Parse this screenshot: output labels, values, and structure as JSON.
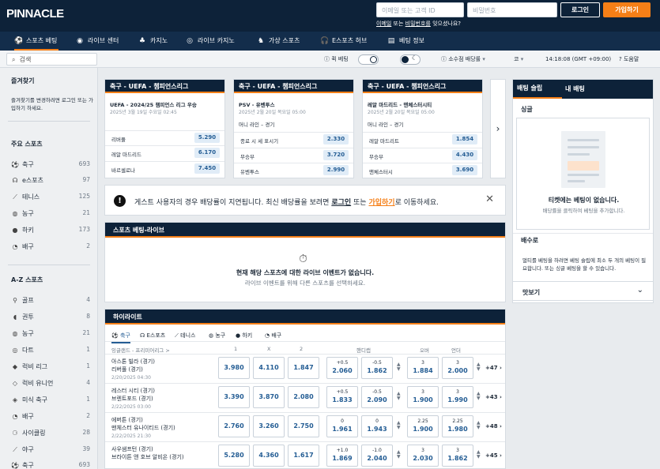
{
  "brand": {
    "logo": "PINNACLE",
    "accent": "#f57f17",
    "navy": "#0d2239"
  },
  "header": {
    "email_placeholder": "이메일 또는 고객 ID",
    "password_placeholder": "비밀번호",
    "login": "로그인",
    "join": "가입하기",
    "forgot_pre": "이메일",
    "forgot_mid": " 또는 ",
    "forgot_link": "비밀번호를",
    "forgot_post": " 잊으셨나요?"
  },
  "nav": [
    "스포츠 베팅",
    "라이브 센터",
    "카지노",
    "라이브 카지노",
    "가상 스포츠",
    "E스포츠 허브",
    "베팅 정보"
  ],
  "utility": {
    "search": "검색",
    "quick_bet": "퀵 베팅",
    "decimal_odds": "소수점 배당률",
    "language": "코",
    "time": "14:18:08 (GMT +09:00)",
    "help": "도움말"
  },
  "sidebar": {
    "favorites_title": "즐겨찾기",
    "favorites_text": "즐겨찾기를 변경하려면 로그인 또는 가입하기 하세요.",
    "main_title": "주요 스포츠",
    "main": [
      {
        "label": "축구",
        "count": "693"
      },
      {
        "label": "e스포츠",
        "count": "97"
      },
      {
        "label": "테니스",
        "count": "125"
      },
      {
        "label": "농구",
        "count": "21"
      },
      {
        "label": "하키",
        "count": "173"
      },
      {
        "label": "배구",
        "count": "2"
      }
    ],
    "az_title": "A-Z 스포츠",
    "az": [
      {
        "label": "골프",
        "count": "4"
      },
      {
        "label": "권투",
        "count": "8"
      },
      {
        "label": "농구",
        "count": "21"
      },
      {
        "label": "다트",
        "count": "1"
      },
      {
        "label": "럭비 리그",
        "count": "1"
      },
      {
        "label": "럭비 유니언",
        "count": "4"
      },
      {
        "label": "미식 축구",
        "count": "1"
      },
      {
        "label": "배구",
        "count": "2"
      },
      {
        "label": "사이클링",
        "count": "28"
      },
      {
        "label": "야구",
        "count": "39"
      },
      {
        "label": "축구",
        "count": "693"
      }
    ]
  },
  "cards": [
    {
      "header": "축구 - UEFA - 챔피언스리그",
      "title": "UEFA - 2024/25 챔피언스 리그 우승",
      "date": "2025년 3월 19일 수요일 02:45",
      "market": "",
      "rows": [
        {
          "name": "리버풀",
          "odd": "5.290"
        },
        {
          "name": "레알 마드리드",
          "odd": "6.170"
        },
        {
          "name": "바르셀로나",
          "odd": "7.450"
        }
      ]
    },
    {
      "header": "축구 - UEFA - 챔피언스리그",
      "title": "PSV - 유벤투스",
      "date": "2025년 2월 20일 목요일 05:00",
      "market": "머니 라인 – 경기",
      "rows": [
        {
          "name": "종료 시 세 표시기",
          "odd": "2.330"
        },
        {
          "name": "무승부",
          "odd": "3.720"
        },
        {
          "name": "유벤투스",
          "odd": "2.990"
        }
      ]
    },
    {
      "header": "축구 - UEFA - 챔피언스리그",
      "title": "레알 마드리드 - 맨체스터시티",
      "date": "2025년 2월 20일 목요일 05:00",
      "market": "머니 라인 – 경기",
      "rows": [
        {
          "name": "레알 마드리트",
          "odd": "1.854"
        },
        {
          "name": "무승부",
          "odd": "4.430"
        },
        {
          "name": "맨체스터시",
          "odd": "3.690"
        }
      ]
    }
  ],
  "banner": {
    "pre": "게스트 사용자의 경우 배당률이 지연됩니다. 최신 배당률을 보려면 ",
    "login": "로그인",
    "mid": " 또는 ",
    "join": "가입하기",
    "post": "로 이동하세요."
  },
  "live": {
    "title": "스포츠 베팅-라이브",
    "none": "현재 해당 스포츠에 대한 라이브 이벤트가 없습니다.",
    "hint": "라이브 이벤트를 위해 다른 스포츠를 선택하세요."
  },
  "highlights": {
    "title": "하이라이트",
    "tabs": [
      "축구",
      "E스포츠",
      "테니스",
      "농구",
      "하키",
      "배구"
    ],
    "league": "잉글랜드 - 프리미어리그 >",
    "col_1": "1",
    "col_x": "X",
    "col_2": "2",
    "col_handicap": "핸디캡",
    "col_over": "오버",
    "col_under": "언더",
    "rows": [
      {
        "home": "아스톤 빌라 (경기)",
        "away": "리버풀 (경기)",
        "date": "2/20/2025 04:30",
        "o1": "3.980",
        "ox": "4.110",
        "o2": "1.847",
        "h1": "+0.5",
        "h1p": "2.060",
        "h2": "-0.5",
        "h2p": "1.862",
        "t1": "3",
        "t1p": "1.884",
        "t2": "3",
        "t2p": "2.000",
        "more": "+47"
      },
      {
        "home": "레스터 시티 (경기)",
        "away": "브렌트포드 (경기)",
        "date": "2/22/2025 03:00",
        "o1": "3.390",
        "ox": "3.870",
        "o2": "2.080",
        "h1": "+0.5",
        "h1p": "1.833",
        "h2": "-0.5",
        "h2p": "2.090",
        "t1": "3",
        "t1p": "1.900",
        "t2": "3",
        "t2p": "1.990",
        "more": "+43"
      },
      {
        "home": "에버튼 (경기)",
        "away": "맨체스터 유나이티드 (경기)",
        "date": "2/22/2025 21:30",
        "o1": "2.760",
        "ox": "3.260",
        "o2": "2.750",
        "h1": "0",
        "h1p": "1.961",
        "h2": "0",
        "h2p": "1.943",
        "t1": "2.25",
        "t1p": "1.900",
        "t2": "2.25",
        "t2p": "1.980",
        "more": "+48"
      },
      {
        "home": "사우샘프턴 (경기)",
        "away": "브라이튼 앤 호브 알비온 (경기)",
        "date": "",
        "o1": "5.280",
        "ox": "4.360",
        "o2": "1.617",
        "h1": "+1.0",
        "h1p": "1.869",
        "h2": "-1.0",
        "h2p": "2.040",
        "t1": "3",
        "t1p": "2.030",
        "t2": "3",
        "t2p": "1.862",
        "more": "+45"
      }
    ]
  },
  "betslip": {
    "tab_slip": "배팅 슬립",
    "tab_my": "내 배팅",
    "single": "싱글",
    "empty_title": "티켓에는 베팅이 없습니다.",
    "empty_hint": "배당률을 클릭하여 베팅을 추가합니다.",
    "return_title": "배수로",
    "return_text": "멀티를 베팅을 하려면 베팅 슬립에 최소 두 개의 베팅이 필요합니다. 또는 싱글 베팅을 할 수 있습니다.",
    "preview": "맛보기"
  }
}
